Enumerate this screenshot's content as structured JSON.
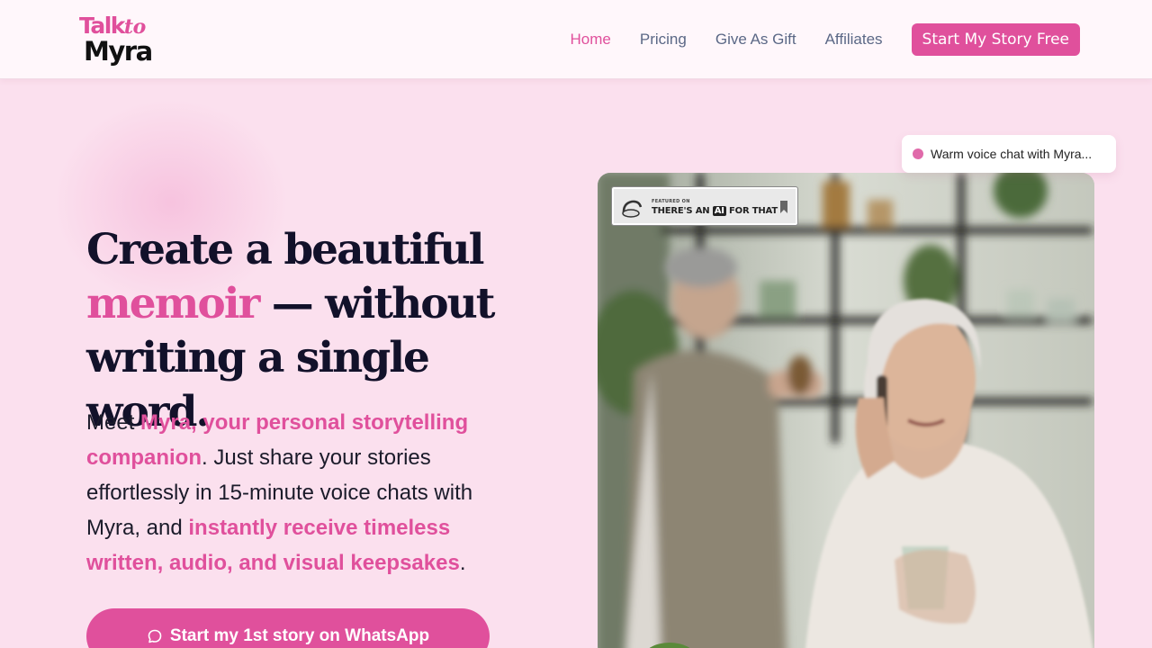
{
  "header": {
    "logo_line1": "Talk",
    "logo_line1_italic": "to",
    "logo_line2": "Myra",
    "nav": [
      {
        "label": "Home",
        "active": true
      },
      {
        "label": "Pricing"
      },
      {
        "label": "Give As Gift"
      },
      {
        "label": "Affiliates"
      }
    ],
    "cta_label": "Start My Story Free"
  },
  "hero": {
    "headline_part1": "Create a beautiful ",
    "headline_highlight": "memoir",
    "headline_part2": " — without writing a single word.",
    "sub_prefix": "Meet ",
    "sub_highlight1": "Myra, your personal storytelling companion",
    "sub_middle": ". Just share your stories effortlessly in 15-minute voice chats with Myra, and ",
    "sub_highlight2": "instantly receive timeless written, audio, and visual keepsakes",
    "sub_suffix": ".",
    "button_label": "Start my 1st story on WhatsApp",
    "button_icon": "chat-bubble-icon"
  },
  "badge": {
    "small_text": "FEATURED ON",
    "prefix": "THERE'S AN ",
    "ai": "AI",
    "suffix": " FOR THAT"
  },
  "chip": {
    "text": "Warm voice chat with Myra..."
  },
  "colors": {
    "accent": "#e0509c",
    "background": "#fbe0ee",
    "header_bg": "#fff7fb",
    "heading": "#12112a",
    "nav_text": "#5b6886"
  }
}
